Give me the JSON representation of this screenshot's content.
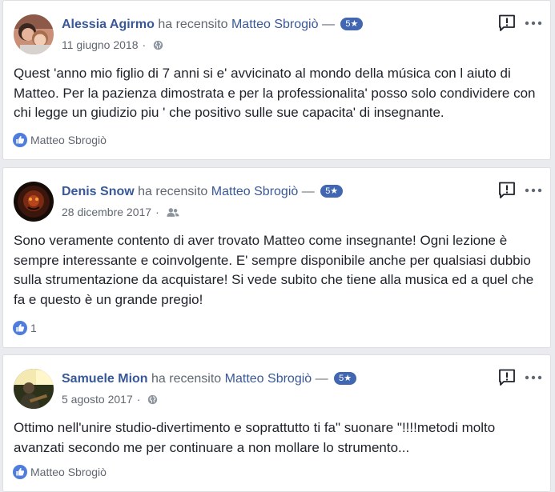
{
  "reviews": [
    {
      "name": "Alessia Agirmo",
      "verb": "ha recensito",
      "target": "Matteo Sbrogiò",
      "dash": "—",
      "rating": "5★",
      "date": "11 giugno 2018",
      "sep": "·",
      "audience_icon": "globe-icon",
      "text": "Quest 'anno mio figlio di 7 anni si e' avvicinato al mondo della música con l aiuto di Matteo. Per la pazienza dimostrata e per la professionalita' posso solo condividere con chi legge un giudizio piu ' che positivo sulle sue capacita' di insegnante.",
      "footer": "Matteo Sbrogiò"
    },
    {
      "name": "Denis Snow",
      "verb": "ha recensito",
      "target": "Matteo Sbrogiò",
      "dash": "—",
      "rating": "5★",
      "date": "28 dicembre 2017",
      "sep": "·",
      "audience_icon": "friends-icon",
      "text": "Sono veramente contento di aver trovato Matteo come insegnante! Ogni lezione è sempre interessante e coinvolgente. E' sempre disponibile anche per qualsiasi dubbio sulla strumentazione da acquistare! Si vede subito che tiene alla musica ed a quel che fa e questo è un grande pregio!",
      "footer": "1"
    },
    {
      "name": "Samuele Mion",
      "verb": "ha recensito",
      "target": "Matteo Sbrogiò",
      "dash": "—",
      "rating": "5★",
      "date": "5 agosto 2017",
      "sep": "·",
      "audience_icon": "globe-icon",
      "text": "Ottimo nell'unire studio-divertimento e soprattutto ti fa\" suonare \"!!!!metodi molto avanzati secondo me per continuare a non mollare lo strumento...",
      "footer": "Matteo Sbrogiò"
    }
  ],
  "icons": {
    "report": "report-icon",
    "more": "more-options-icon",
    "like": "like-icon"
  },
  "colors": {
    "link": "#385898",
    "badge": "#4267b2",
    "secondary": "#606770",
    "text": "#1d2129",
    "background": "#e9ebee"
  }
}
